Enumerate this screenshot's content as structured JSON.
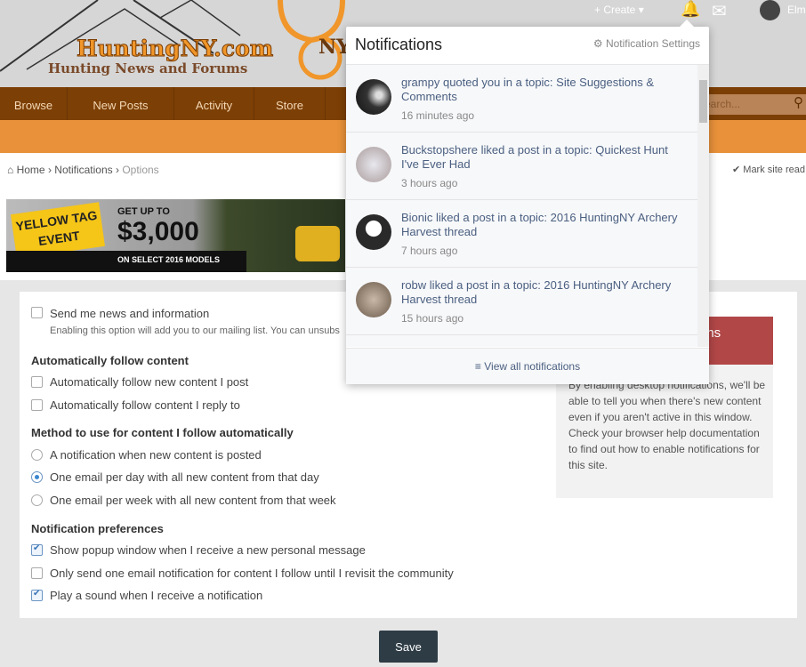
{
  "header": {
    "logo_title": "HuntingNY.com",
    "logo_subtitle": "Hunting News and Forums",
    "logo_badge": "NY",
    "create_label": "+ Create ▾",
    "user_name": "Elm"
  },
  "nav": {
    "tabs": [
      "Browse",
      "New Posts",
      "Activity",
      "Store"
    ],
    "search_placeholder": "Search..."
  },
  "breadcrumb": {
    "home": "Home",
    "notifications": "Notifications",
    "current": "Options",
    "mark_read": "Mark site read"
  },
  "banner": {
    "tag": "YELLOW TAG EVENT",
    "line1": "GET UP TO",
    "amount": "$3,000",
    "line2": "ON SELECT 2016 MODELS"
  },
  "form": {
    "news": {
      "label": "Send me news and information",
      "checked": false,
      "desc": "Enabling this option will add you to our mailing list. You can unsubs"
    },
    "auto_follow": {
      "heading": "Automatically follow content",
      "options": [
        {
          "label": "Automatically follow new content I post",
          "checked": false
        },
        {
          "label": "Automatically follow content I reply to",
          "checked": false
        }
      ]
    },
    "method": {
      "heading": "Method to use for content I follow automatically",
      "options": [
        {
          "label": "A notification when new content is posted",
          "selected": false
        },
        {
          "label": "One email per day with all new content from that day",
          "selected": true
        },
        {
          "label": "One email per week with all new content from that week",
          "selected": false
        }
      ]
    },
    "prefs": {
      "heading": "Notification preferences",
      "options": [
        {
          "label": "Show popup window when I receive a new personal message",
          "checked": true
        },
        {
          "label": "Only send one email notification for content I follow until I revisit the community",
          "checked": false
        },
        {
          "label": "Play a sound when I receive a notification",
          "checked": true
        }
      ]
    },
    "save_label": "Save"
  },
  "sidebar": {
    "title_fragment": "ons",
    "text": "By enabling desktop notifications, we'll be able to tell you when there's new content even if you aren't active in this window. Check your browser help documentation to find out how to enable notifications for this site."
  },
  "popup": {
    "title": "Notifications",
    "settings_label": "Notification Settings",
    "view_all": "View all notifications",
    "items": [
      {
        "text": "grampy quoted you in a topic: Site Suggestions & Comments",
        "time": "16 minutes ago"
      },
      {
        "text": "Buckstopshere liked a post in a topic: Quickest Hunt I've Ever Had",
        "time": "3 hours ago"
      },
      {
        "text": "Bionic liked a post in a topic: 2016 HuntingNY Archery Harvest thread",
        "time": "7 hours ago"
      },
      {
        "text": "robw liked a post in a topic: 2016 HuntingNY Archery Harvest thread",
        "time": "15 hours ago"
      }
    ]
  },
  "colors": {
    "nav": "#7c3f05",
    "orange": "#e8913a",
    "sidebar_head": "#b24747",
    "save": "#2e3c45",
    "link": "#4a5f80"
  }
}
